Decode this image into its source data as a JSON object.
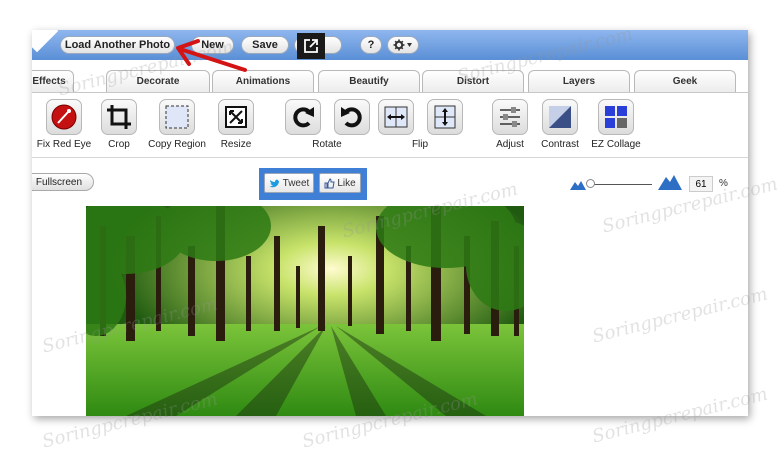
{
  "topbar": {
    "load_label": "Load Another Photo",
    "new_label": "New",
    "save_label": "Save",
    "help_label": "?"
  },
  "tabs": [
    {
      "label": "Effects"
    },
    {
      "label": "Decorate"
    },
    {
      "label": "Animations"
    },
    {
      "label": "Beautify"
    },
    {
      "label": "Distort"
    },
    {
      "label": "Layers"
    },
    {
      "label": "Geek"
    }
  ],
  "tools": [
    {
      "label": "Fix Red Eye",
      "icon": "red-eye-icon"
    },
    {
      "label": "Crop",
      "icon": "crop-icon"
    },
    {
      "label": "Copy Region",
      "icon": "copy-region-icon"
    },
    {
      "label": "Resize",
      "icon": "resize-icon"
    },
    {
      "label": "Rotate",
      "icon": "rotate-icon"
    },
    {
      "label": "Flip",
      "icon": "flip-icon"
    },
    {
      "label": "Adjust",
      "icon": "adjust-icon"
    },
    {
      "label": "Contrast",
      "icon": "contrast-icon"
    },
    {
      "label": "EZ Collage",
      "icon": "collage-icon"
    }
  ],
  "view": {
    "fullscreen_label": "Fullscreen",
    "tweet_label": "Tweet",
    "like_label": "Like",
    "zoom_value": "61",
    "zoom_unit": "%"
  },
  "watermark": "Soringpcrepair.com",
  "colors": {
    "topbar": "#5a8fd6",
    "social_bg": "#3f7fd6",
    "arrow": "#d41414",
    "forest": "#2f7a16"
  }
}
